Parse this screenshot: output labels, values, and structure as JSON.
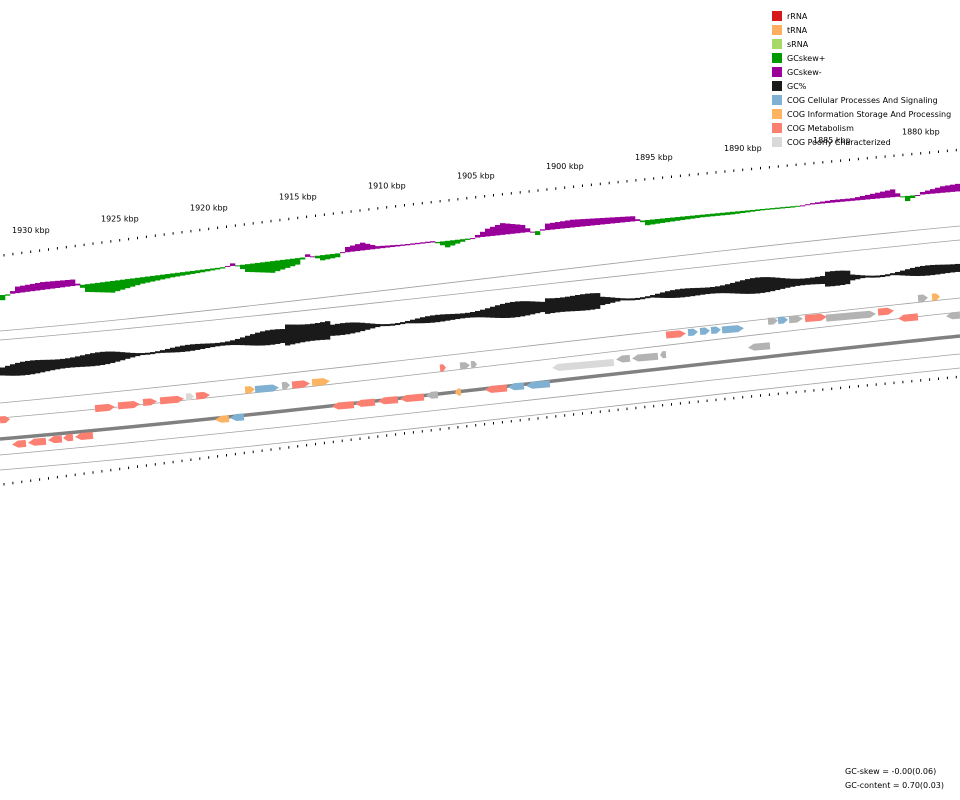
{
  "legend": [
    {
      "label": "rRNA",
      "color": "#d7191c",
      "icon": "rrna-swatch"
    },
    {
      "label": "tRNA",
      "color": "#fdae61",
      "icon": "trna-swatch"
    },
    {
      "label": "sRNA",
      "color": "#a6d96a",
      "icon": "srna-swatch"
    },
    {
      "label": "GCskew+",
      "color": "#009900",
      "icon": "gcskew-plus-swatch"
    },
    {
      "label": "GCskew-",
      "color": "#990099",
      "icon": "gcskew-minus-swatch"
    },
    {
      "label": "GC%",
      "color": "#1a1a1a",
      "icon": "gc-percent-swatch"
    },
    {
      "label": "COG Cellular Processes And Signaling",
      "color": "#80b1d3",
      "icon": "cog-cellular-swatch"
    },
    {
      "label": "COG Information Storage And Processing",
      "color": "#fdb462",
      "icon": "cog-information-swatch"
    },
    {
      "label": "COG Metabolism",
      "color": "#fb8072",
      "icon": "cog-metabolism-swatch"
    },
    {
      "label": "COG Poorly Characterized",
      "color": "#d9d9d9",
      "icon": "cog-poorly-swatch"
    }
  ],
  "ticks": [
    {
      "label": "1930 kbp",
      "kbp": 1930
    },
    {
      "label": "1925 kbp",
      "kbp": 1925
    },
    {
      "label": "1920 kbp",
      "kbp": 1920
    },
    {
      "label": "1915 kbp",
      "kbp": 1915
    },
    {
      "label": "1910 kbp",
      "kbp": 1910
    },
    {
      "label": "1905 kbp",
      "kbp": 1905
    },
    {
      "label": "1900 kbp",
      "kbp": 1900
    },
    {
      "label": "1895 kbp",
      "kbp": 1895
    },
    {
      "label": "1890 kbp",
      "kbp": 1890
    },
    {
      "label": "1885 kbp",
      "kbp": 1885
    },
    {
      "label": "1880 kbp",
      "kbp": 1880
    }
  ],
  "stats": {
    "gc_skew": "GC-skew = -0.00(0.06)",
    "gc_content": "GC-content = 0.70(0.03)"
  },
  "colors": {
    "cellular": "#80b1d3",
    "information": "#fdb462",
    "metabolism": "#fb8072",
    "poorly": "#d9d9d9",
    "unknown": "#b3b3b3",
    "gcskew_plus": "#009900",
    "gcskew_minus": "#990099",
    "gc_percent": "#1a1a1a",
    "backbone": "#808080"
  }
}
